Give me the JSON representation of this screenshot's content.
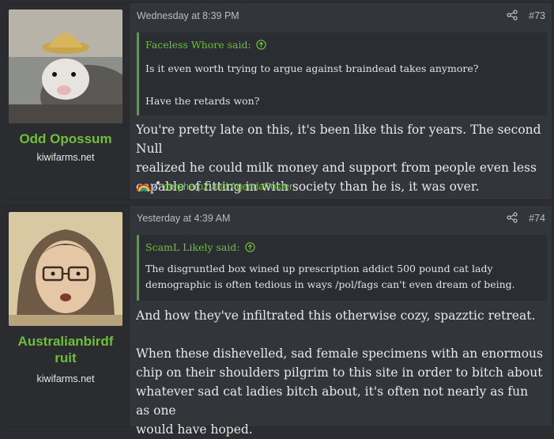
{
  "posts": [
    {
      "username": "Odd Opossum",
      "site": "kiwifarms.net",
      "date": "Wednesday at 8:39 PM",
      "number": "#73",
      "quote": {
        "author_line": "Faceless Whore said:",
        "lines": [
          "Is it even worth trying to argue against braindead takes anymore?",
          "Have the retards won?"
        ]
      },
      "body_lines": [
        "You're pretty late on this, it's been like this for years. The second Null",
        "realized he could milk money and support from people even less",
        "capable of fitting in with society than he is, it was over."
      ],
      "reactions": "derpherp2 and AgendaPoster"
    },
    {
      "username_lines": [
        "Australianbirdf",
        "ruit"
      ],
      "site": "kiwifarms.net",
      "date": "Yesterday at 4:39 AM",
      "number": "#74",
      "quote": {
        "author_line": "ScamL Likely said:",
        "lines": [
          "The disgruntled box wined up prescription addict 500 pound cat lady",
          "demographic is often tedious in ways /pol/fags can't even dream of being."
        ]
      },
      "body_paragraphs": [
        [
          "And how they've infiltrated this otherwise cozy, spazztic retreat."
        ],
        [
          "When these dishevelled, sad female specimens with an enormous",
          "chip on their shoulders pilgrim to this site in order to bitch about",
          "whatever sad cat ladies bitch about, it's often not nearly as fun as one",
          "would have hoped."
        ]
      ]
    }
  ],
  "icons": {
    "share": "share-icon",
    "quote_arrow": "arrow-up-circle-icon",
    "reaction_rainbow": "rainbow-icon",
    "reaction_autism": "autism-icon"
  },
  "colors": {
    "accent": "#6fbf3a",
    "quote_border": "#5a9e3a",
    "post_bg": "#32353a",
    "user_bg": "#2a2c30"
  }
}
